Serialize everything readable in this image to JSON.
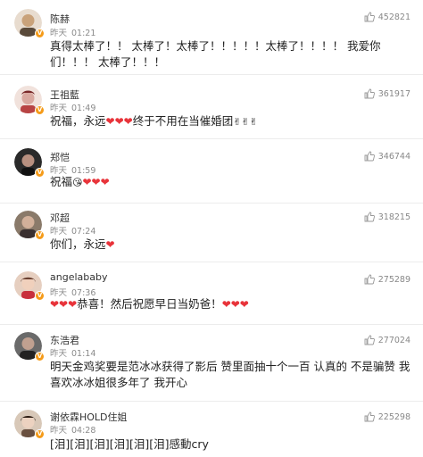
{
  "comments": [
    {
      "name": "陈赫",
      "date": "昨天",
      "time": "01:21",
      "likes": "452821",
      "text": "真得太棒了！！  太棒了！太棒了！！！！！太棒了！！！！  我爱你们！！！  太棒了！！！",
      "avatar_color": "#c9a27a"
    },
    {
      "name": "王祖藍",
      "date": "昨天",
      "time": "01:49",
      "likes": "361917",
      "text_before": "祝福，永远",
      "hearts": "❤❤❤",
      "text_after": "终于不用在当催婚团",
      "emoji_after": "✌✌✌",
      "avatar_color": "#d9a9a0"
    },
    {
      "name": "郑恺",
      "date": "昨天",
      "time": "01:59",
      "likes": "346744",
      "text_before": "祝福",
      "emoji": "😘",
      "hearts": "❤❤❤",
      "avatar_color": "#3b3b3b"
    },
    {
      "name": "邓超",
      "date": "昨天",
      "time": "07:24",
      "likes": "318215",
      "text_before": "你们，永远",
      "hearts": "❤",
      "avatar_color": "#6d5a4a"
    },
    {
      "name": "angelababy",
      "date": "昨天",
      "time": "07:36",
      "likes": "275289",
      "hearts_before": "❤❤❤",
      "text_middle": "恭喜！然后祝愿早日当奶爸！",
      "hearts_after": "❤❤❤",
      "avatar_color": "#e0b7a0"
    },
    {
      "name": "东浩君",
      "date": "昨天",
      "time": "01:14",
      "likes": "277024",
      "text": "明天金鸡奖要是范冰冰获得了影后  赞里面抽十个一百  认真的  不是骗赞  我喜欢冰冰姐很多年了  我开心",
      "avatar_color": "#4a4a4a"
    },
    {
      "name": "谢依霖HOLD住姐",
      "date": "昨天",
      "time": "04:28",
      "likes": "225298",
      "text": "[泪][泪][泪][泪][泪][泪]感動cry",
      "avatar_color": "#c8b8a8"
    }
  ],
  "icons": {
    "like": "thumbs-up-icon",
    "verified": "verified-v-badge-icon"
  },
  "colors": {
    "heart": "#e8333a",
    "badge": "#f59b19",
    "meta": "#8a8a8a"
  }
}
